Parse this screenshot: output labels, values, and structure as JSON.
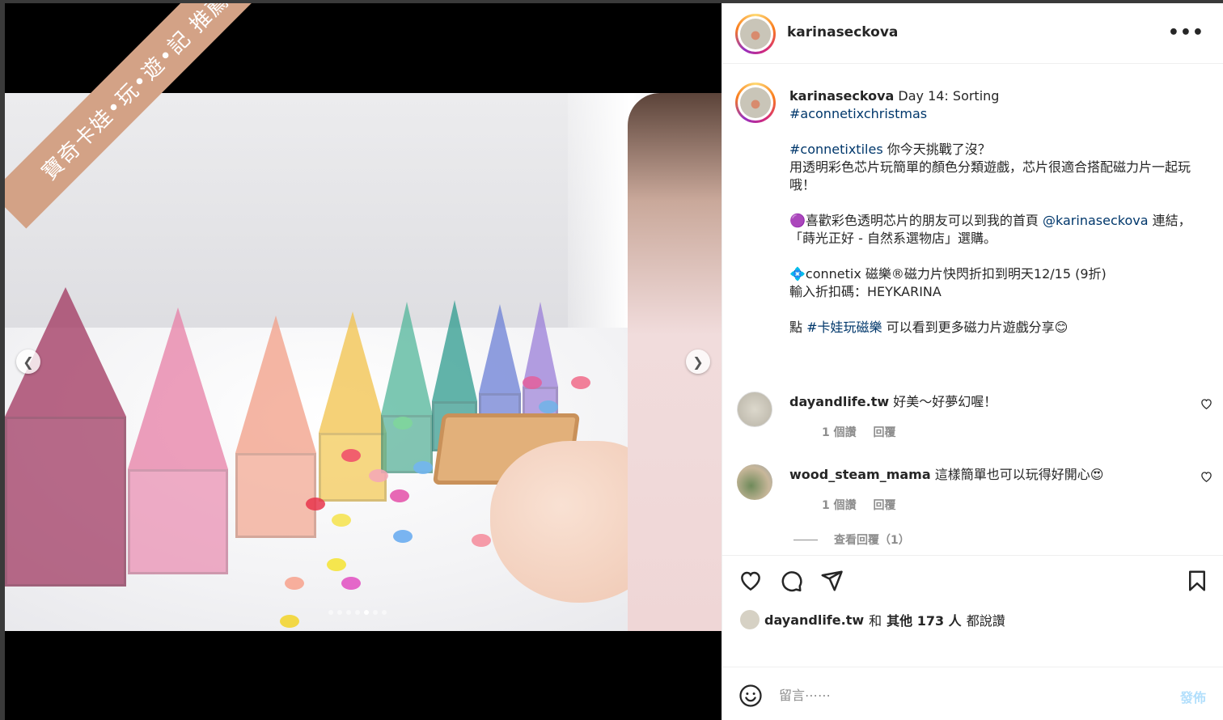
{
  "watermark": "寶奇卡娃•玩•遊•記 推薦",
  "carousel": {
    "dot_count": 7,
    "active_index": 4,
    "prev_icon": "chevron-left-icon",
    "next_icon": "chevron-right-icon"
  },
  "post": {
    "author": "karinaseckova",
    "more_icon": "more-horizontal-icon",
    "caption": {
      "author": "karinaseckova",
      "title": "Day 14: Sorting",
      "hashtag_title": "#aconnetixchristmas",
      "p2_tag": "#connetixtiles",
      "p2_text1": " 你今天挑戰了沒？",
      "p2_text2": "用透明彩色芯片玩簡單的顏色分類遊戲，芯片很適合搭配磁力片一起玩哦！",
      "p3_text1": "🟣喜歡彩色透明芯片的朋友可以到我的首頁 ",
      "p3_mention": "@karinaseckova",
      "p3_text2": " 連結，「蒔光正好 - 自然系選物店」選購。",
      "p4_text1": "💠connetix 磁樂®磁力片快閃折扣到明天12/15 (9折)",
      "p4_text2": "輸入折扣碼：HEYKARINA",
      "p5_text1": "點 ",
      "p5_tag": "#卡娃玩磁樂",
      "p5_text2": " 可以看到更多磁力片遊戲分享😊"
    },
    "comments": [
      {
        "user": "dayandlife.tw",
        "text": "好美～好夢幻喔！",
        "likes": "1 個讚",
        "reply": "回覆"
      },
      {
        "user": "wood_steam_mama",
        "text": "這樣簡單也可以玩得好開心😍",
        "likes": "1 個讚",
        "reply": "回覆"
      }
    ],
    "view_replies": "查看回覆（1）",
    "actions": {
      "like_icon": "heart-icon",
      "comment_icon": "comment-icon",
      "share_icon": "send-icon",
      "save_icon": "bookmark-icon"
    },
    "likes": {
      "user": "dayandlife.tw",
      "joiner": "和",
      "others": "其他 173 人",
      "suffix": "都說讚"
    },
    "add_comment": {
      "placeholder": "留言⋯⋯",
      "post_label": "發佈",
      "emoji_icon": "smiley-icon"
    }
  },
  "colors": {
    "link": "#00376b",
    "muted": "#8e8e8e",
    "post_disabled": "#b2dffc",
    "watermark_bg": "#d3a286"
  }
}
